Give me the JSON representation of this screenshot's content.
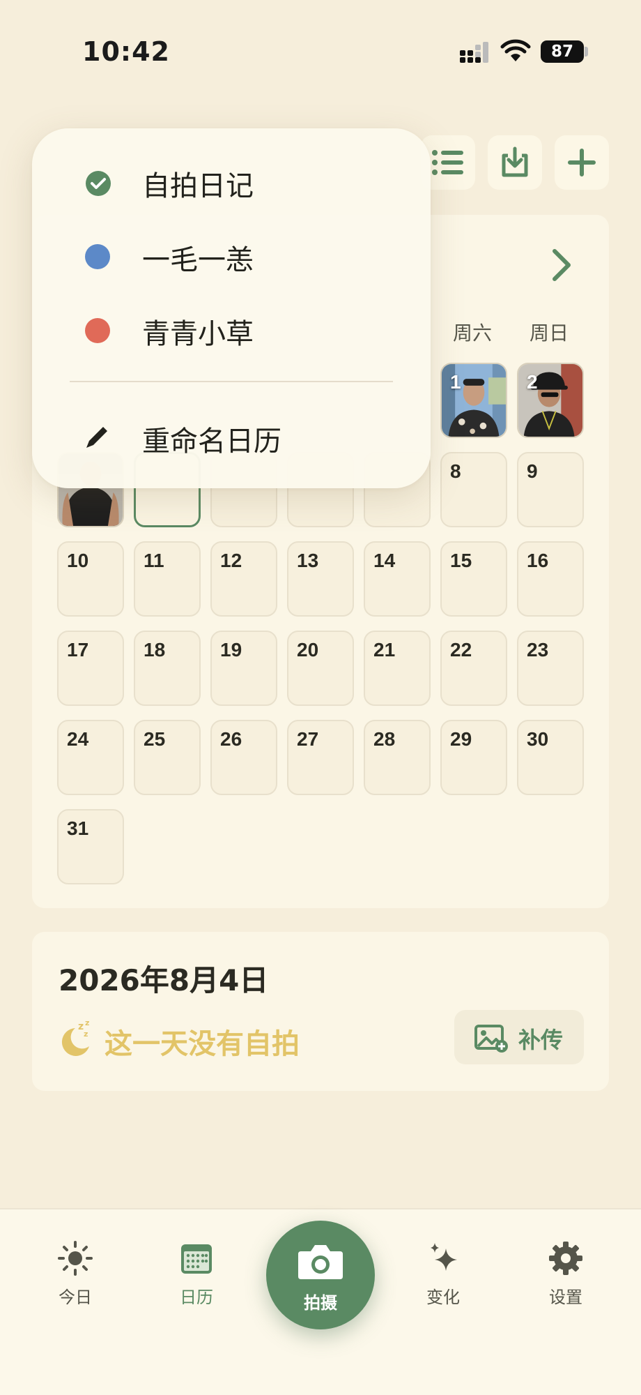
{
  "status_bar": {
    "time": "10:42",
    "battery": "87"
  },
  "toolbar": {
    "icons": [
      "list-icon",
      "download-icon",
      "plus-icon"
    ]
  },
  "calendar": {
    "weekdays_visible": [
      "周六",
      "周日"
    ],
    "photo_days": [
      {
        "day": "1",
        "label": "1"
      },
      {
        "day": "2",
        "label": "2"
      }
    ],
    "today_cell": "4",
    "days": [
      "8",
      "9",
      "10",
      "11",
      "12",
      "13",
      "14",
      "15",
      "16",
      "17",
      "18",
      "19",
      "20",
      "21",
      "22",
      "23",
      "24",
      "25",
      "26",
      "27",
      "28",
      "29",
      "30",
      "31"
    ]
  },
  "info": {
    "date": "2026年8月4日",
    "empty_message": "这一天没有自拍",
    "upload_label": "补传"
  },
  "dropdown": {
    "items": [
      {
        "label": "自拍日记",
        "color": "#5a8a63",
        "selected": true
      },
      {
        "label": "一毛一恙",
        "color": "#5c89c8",
        "selected": false
      },
      {
        "label": "青青小草",
        "color": "#e06a58",
        "selected": false
      }
    ],
    "rename_label": "重命名日历"
  },
  "tabs": [
    {
      "label": "今日",
      "icon": "sun-icon"
    },
    {
      "label": "日历",
      "icon": "calendar-icon"
    },
    {
      "label": "拍摄",
      "icon": "camera-icon"
    },
    {
      "label": "变化",
      "icon": "sparkle-icon"
    },
    {
      "label": "设置",
      "icon": "gear-icon"
    }
  ],
  "colors": {
    "accent": "#5a8a63",
    "background": "#f6eedb",
    "card": "#fbf6e6",
    "empty_text": "#e2c468"
  }
}
